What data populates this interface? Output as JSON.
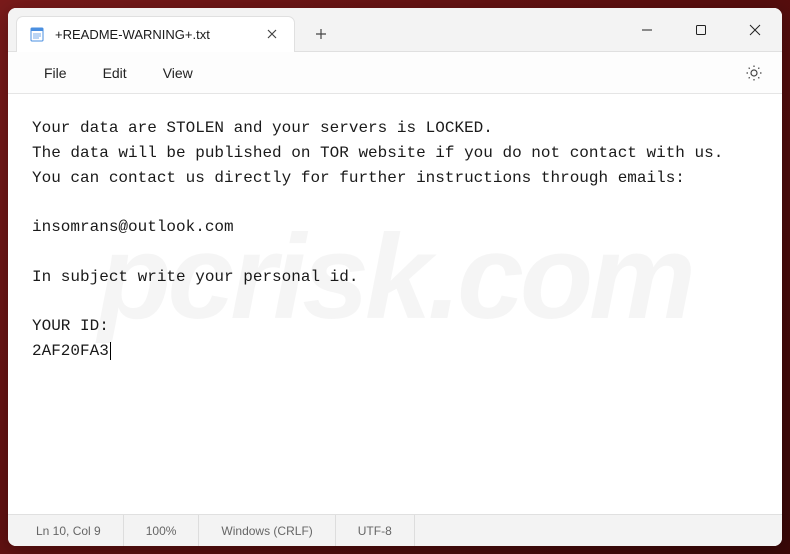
{
  "tab": {
    "title": "+README-WARNING+.txt"
  },
  "menu": {
    "file": "File",
    "edit": "Edit",
    "view": "View"
  },
  "content": {
    "line1": "Your data are STOLEN and your servers is LOCKED.",
    "line2": "The data will be published on TOR website if you do not contact with us.",
    "line3": "You can contact us directly for further instructions through emails:",
    "line4": "",
    "line5": "insomrans@outlook.com",
    "line6": "",
    "line7": "In subject write your personal id.",
    "line8": "",
    "line9": "YOUR ID:",
    "line10": "2AF20FA3"
  },
  "status": {
    "position": "Ln 10, Col 9",
    "zoom": "100%",
    "line_ending": "Windows (CRLF)",
    "encoding": "UTF-8"
  },
  "watermark": "pcrisk.com"
}
